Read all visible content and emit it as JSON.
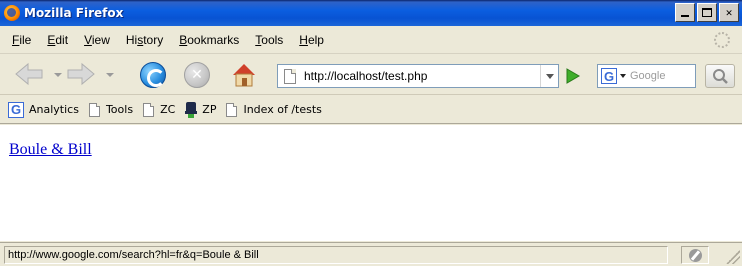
{
  "window": {
    "title": "Mozilla Firefox"
  },
  "menubar": {
    "items": [
      {
        "label_rest": "ile",
        "accel": "F"
      },
      {
        "label_rest": "dit",
        "accel": "E"
      },
      {
        "label_rest": "iew",
        "accel": "V"
      },
      {
        "label_pre": "Hi",
        "accel": "s",
        "label_rest": "tory"
      },
      {
        "label_rest": "ookmarks",
        "accel": "B"
      },
      {
        "label_rest": "ools",
        "accel": "T"
      },
      {
        "label_rest": "elp",
        "accel": "H"
      }
    ]
  },
  "navbar": {
    "url": "http://localhost/test.php",
    "search_placeholder": "Google",
    "search_engine_letter": "G",
    "stop_glyph": "✕"
  },
  "bookmarks": {
    "items": [
      {
        "label": "Analytics",
        "icon": "google-icon"
      },
      {
        "label": "Tools",
        "icon": "page-icon"
      },
      {
        "label": "ZC",
        "icon": "page-icon"
      },
      {
        "label": "ZP",
        "icon": "hat-icon"
      },
      {
        "label": "Index of /tests",
        "icon": "page-icon"
      }
    ],
    "google_letter": "G"
  },
  "content": {
    "link_text": "Boule & Bill"
  },
  "status": {
    "text": "http://www.google.com/search?hl=fr&q=Boule & Bill"
  },
  "colors": {
    "titlebar": "#0b5ee0",
    "link": "#0000cc",
    "chrome": "#ece9d8"
  }
}
